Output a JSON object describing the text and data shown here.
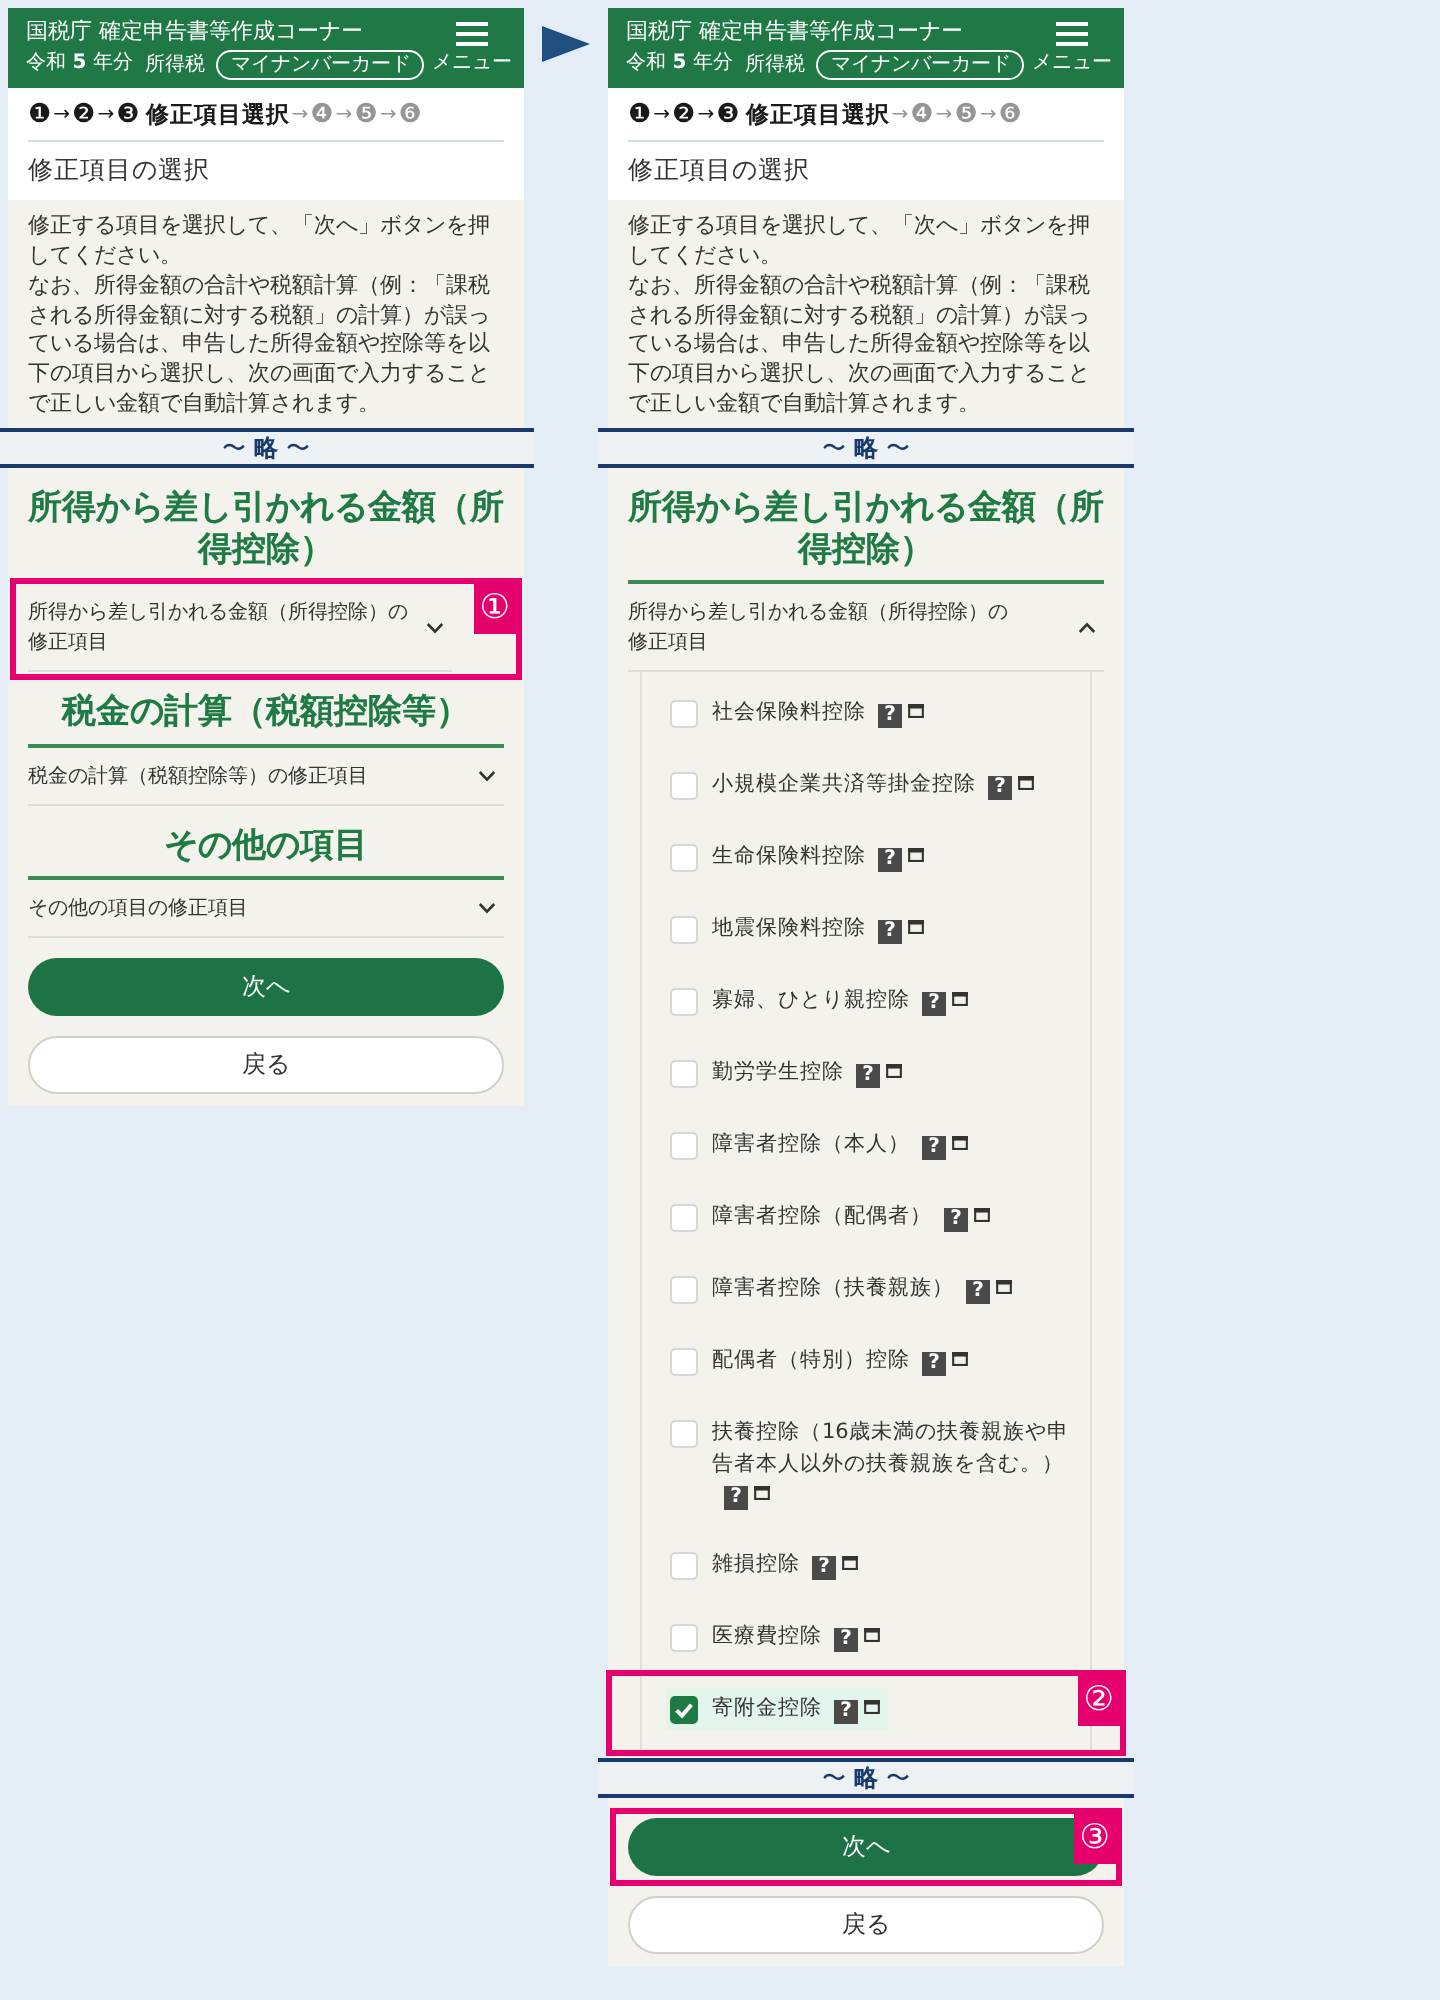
{
  "screens": [
    {
      "header": {
        "title": "国税庁 確定申告書等作成コーナー",
        "year": "令和 **5** 年分",
        "tax": "所得税",
        "auth_badge": "マイナンバーカード",
        "menu_label": "メニュー"
      },
      "steps": [
        {
          "number": "❶",
          "disabled": false
        },
        {
          "arrow": "→",
          "number": "❷",
          "disabled": false
        },
        {
          "arrow": "→",
          "number": "❸",
          "label": "修正項目選択",
          "disabled": false
        },
        {
          "arrow": "→",
          "number": "❹",
          "disabled": true
        },
        {
          "arrow": "→",
          "number": "❺",
          "disabled": true
        },
        {
          "arrow": "→",
          "number": "❻",
          "disabled": true
        }
      ],
      "page_title": "修正項目の選択",
      "blocks": [
        {
          "kind": "intro",
          "paragraphs": [
            "修正する項目を選択して、「次へ」ボタンを押してください。",
            "なお、所得金額の合計や税額計算（例：「課税される所得金額に対する税額」の計算）が誤っている場合は、申告した所得金額や控除等を以下の項目から選択し、次の画面で入力することで正しい金額で自動計算されます。"
          ]
        },
        {
          "kind": "omission",
          "text": "〜 **略** 〜"
        },
        {
          "kind": "heading",
          "text": "所得から差し引かれる金額（所得控除）"
        },
        {
          "kind": "accordion",
          "label": "所得から差し引かれる金額（所得控除）の修正項目",
          "expanded": false,
          "callout": "①"
        },
        {
          "kind": "heading",
          "text": "税金の計算（税額控除等）"
        },
        {
          "kind": "accordion",
          "label": "税金の計算（税額控除等）の修正項目",
          "expanded": false
        },
        {
          "kind": "heading",
          "text": "その他の項目"
        },
        {
          "kind": "accordion",
          "label": "その他の項目の修正項目",
          "expanded": false
        },
        {
          "kind": "primary",
          "label": "次へ"
        },
        {
          "kind": "secondary",
          "label": "戻る"
        }
      ]
    },
    {
      "header": {
        "title": "国税庁 確定申告書等作成コーナー",
        "year": "令和 **5** 年分",
        "tax": "所得税",
        "auth_badge": "マイナンバーカード",
        "menu_label": "メニュー"
      },
      "steps": [
        {
          "number": "❶",
          "disabled": false
        },
        {
          "arrow": "→",
          "number": "❷",
          "disabled": false
        },
        {
          "arrow": "→",
          "number": "❸",
          "label": "修正項目選択",
          "disabled": false
        },
        {
          "arrow": "→",
          "number": "❹",
          "disabled": true
        },
        {
          "arrow": "→",
          "number": "❺",
          "disabled": true
        },
        {
          "arrow": "→",
          "number": "❻",
          "disabled": true
        }
      ],
      "page_title": "修正項目の選択",
      "blocks": [
        {
          "kind": "intro",
          "paragraphs": [
            "修正する項目を選択して、「次へ」ボタンを押してください。",
            "なお、所得金額の合計や税額計算（例：「課税される所得金額に対する税額」の計算）が誤っている場合は、申告した所得金額や控除等を以下の項目から選択し、次の画面で入力することで正しい金額で自動計算されます。"
          ]
        },
        {
          "kind": "omission",
          "text": "〜 **略** 〜"
        },
        {
          "kind": "heading",
          "text": "所得から差し引かれる金額（所得控除）"
        },
        {
          "kind": "accordion",
          "label": "所得から差し引かれる金額（所得控除）の修正項目",
          "expanded": true,
          "options": [
            {
              "label": "社会保険料控除",
              "help": "?",
              "checked": false
            },
            {
              "label": "小規模企業共済等掛金控除",
              "help": "?",
              "checked": false
            },
            {
              "label": "生命保険料控除",
              "help": "?",
              "checked": false
            },
            {
              "label": "地震保険料控除",
              "help": "?",
              "checked": false
            },
            {
              "label": "寡婦、ひとり親控除",
              "help": "?",
              "checked": false
            },
            {
              "label": "勤労学生控除",
              "help": "?",
              "checked": false
            },
            {
              "label": "障害者控除（本人）",
              "help": "?",
              "checked": false
            },
            {
              "label": "障害者控除（配偶者）",
              "help": "?",
              "checked": false
            },
            {
              "label": "障害者控除（扶養親族）",
              "help": "?",
              "checked": false
            },
            {
              "label": "配偶者（特別）控除",
              "help": "?",
              "checked": false
            },
            {
              "label": "扶養控除（16歳未満の扶養親族や申告者本人以外の扶養親族を含む。）",
              "help": "?",
              "checked": false
            },
            {
              "label": "雑損控除",
              "help": "?",
              "checked": false
            },
            {
              "label": "医療費控除",
              "help": "?",
              "checked": false
            },
            {
              "label": "寄附金控除",
              "help": "?",
              "checked": true,
              "callout": "②"
            }
          ]
        },
        {
          "kind": "omission",
          "text": "〜 **略** 〜"
        },
        {
          "kind": "primary",
          "label": "次へ",
          "callout": "③"
        },
        {
          "kind": "secondary",
          "label": "戻る"
        }
      ]
    }
  ]
}
